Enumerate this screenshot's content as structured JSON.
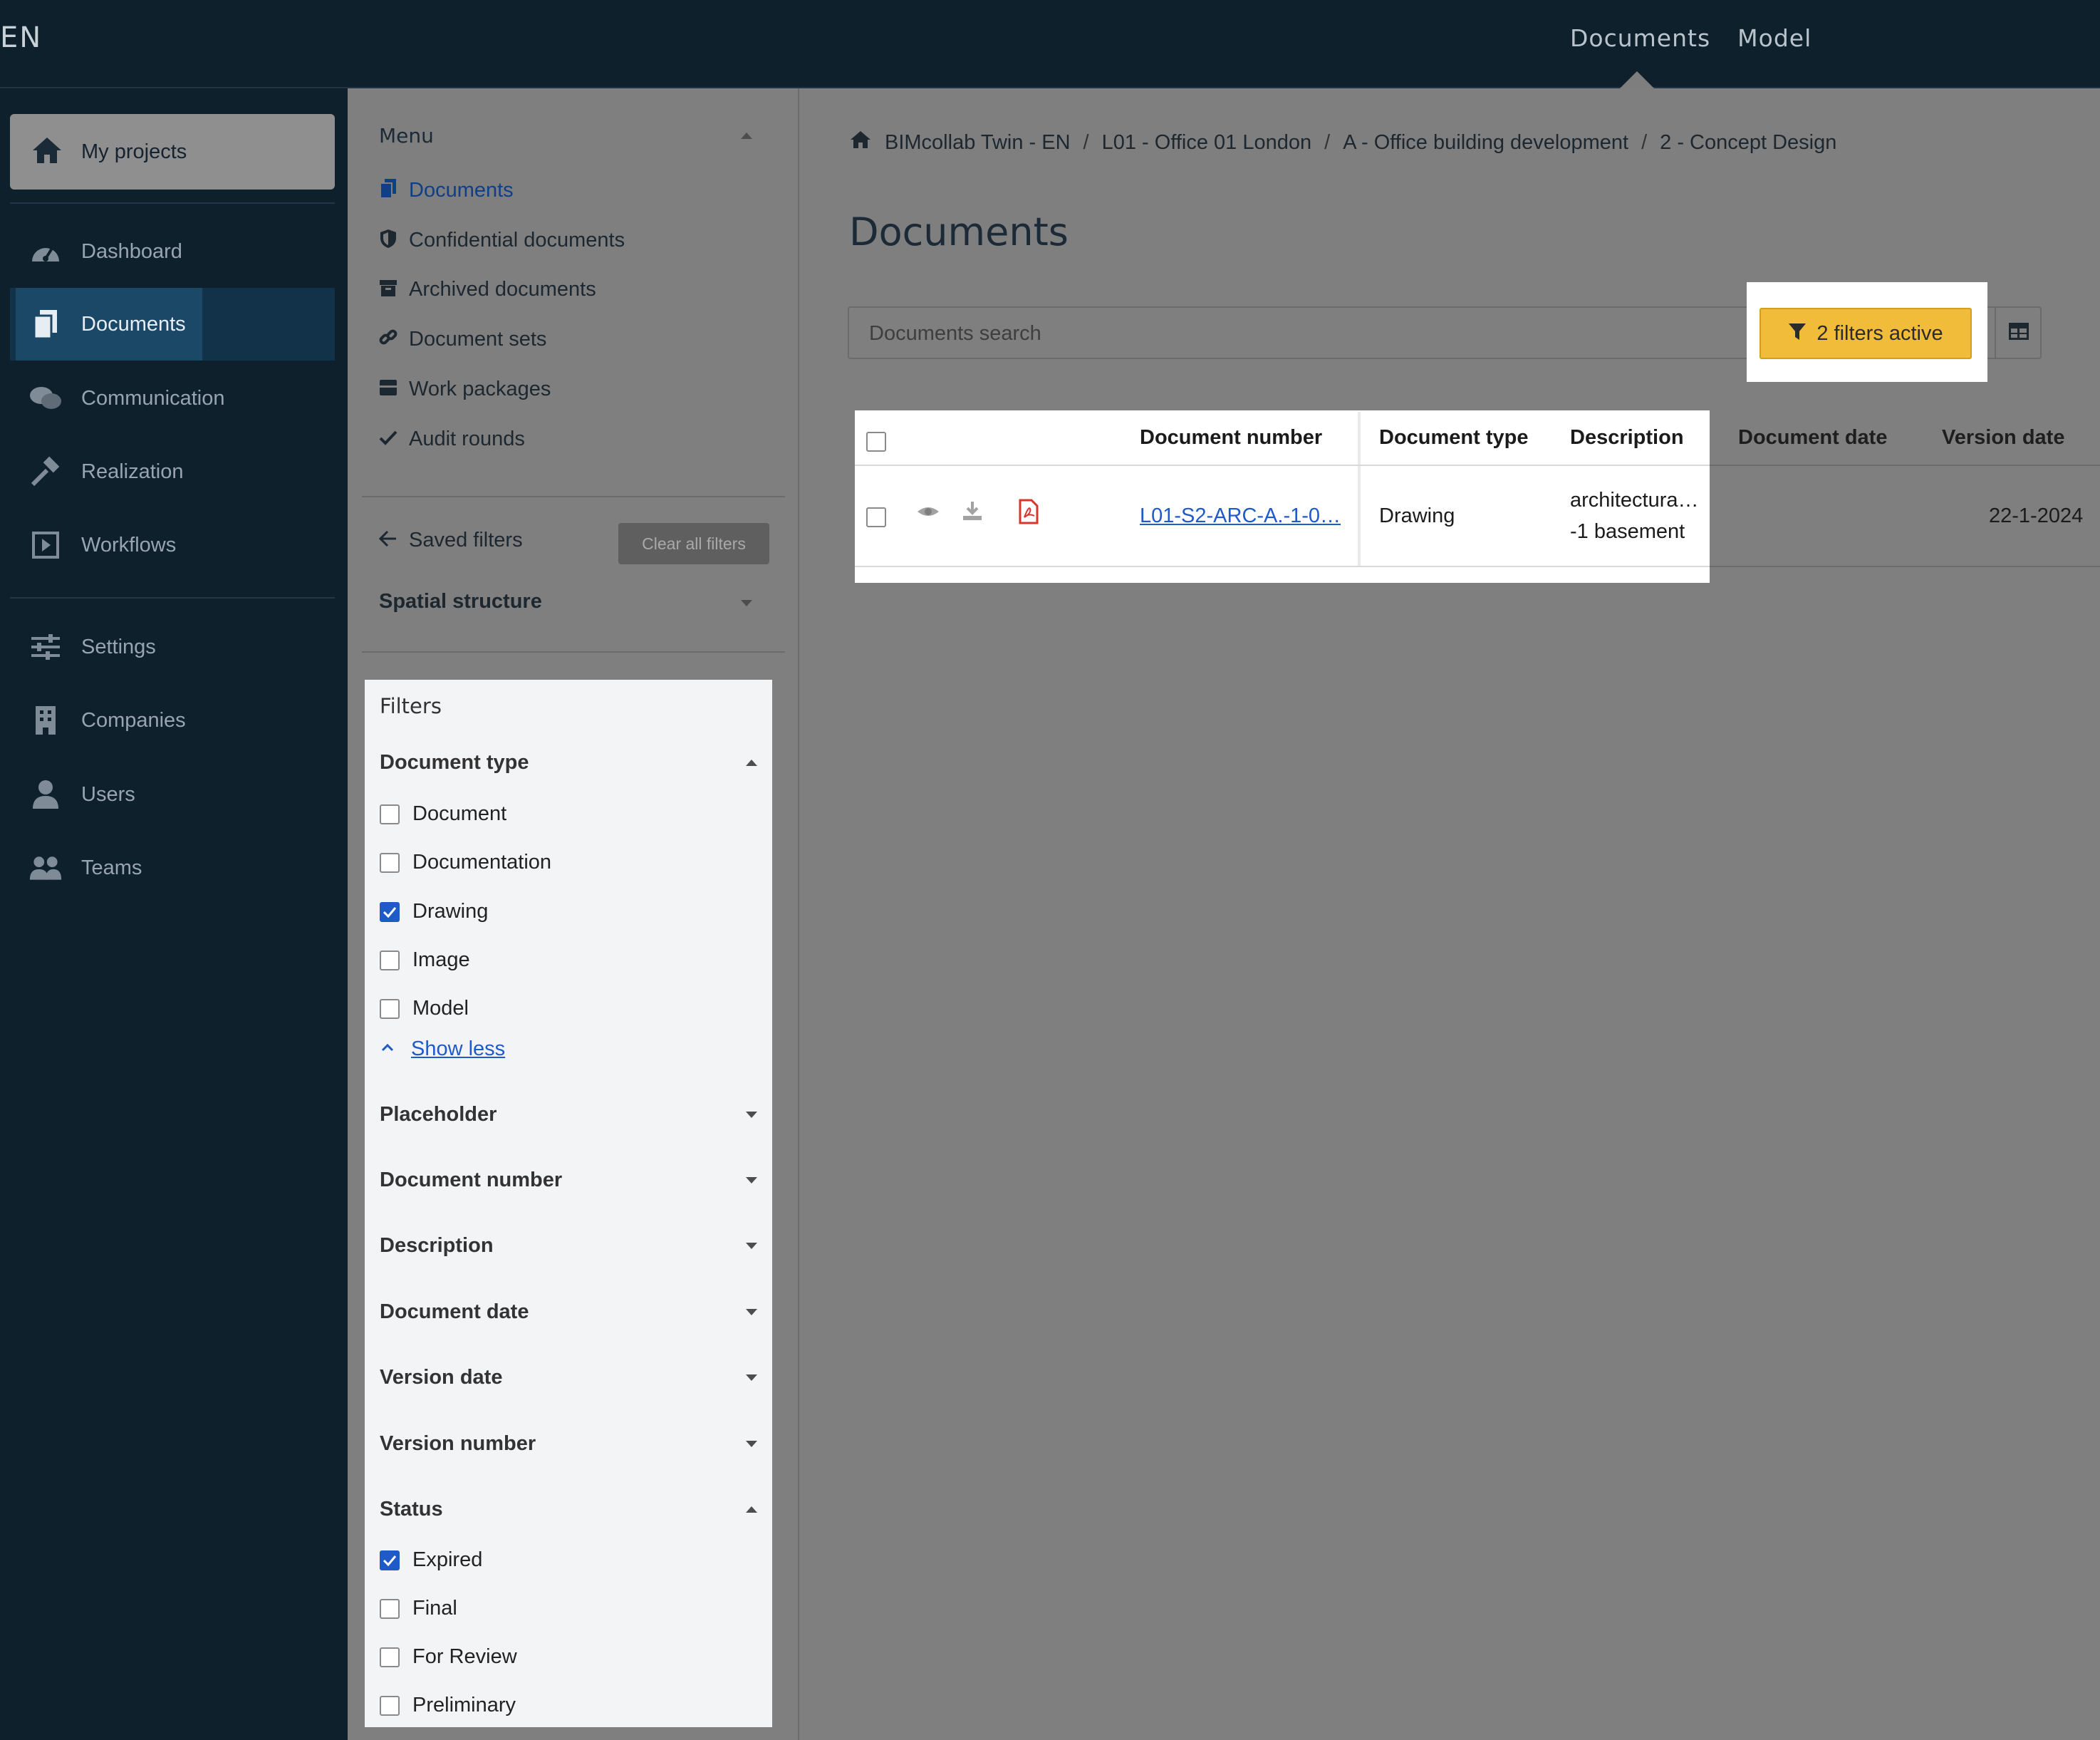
{
  "topbar": {
    "brand": "EN",
    "nav": [
      "Documents",
      "Model"
    ]
  },
  "leftnav": {
    "my_projects": "My projects",
    "items": [
      {
        "label": "Dashboard",
        "icon": "dashboard-icon"
      },
      {
        "label": "Documents",
        "icon": "documents-icon",
        "active": true
      },
      {
        "label": "Communication",
        "icon": "chat-icon"
      },
      {
        "label": "Realization",
        "icon": "hammer-icon"
      },
      {
        "label": "Workflows",
        "icon": "play-square-icon"
      },
      {
        "label": "Settings",
        "icon": "sliders-icon"
      },
      {
        "label": "Companies",
        "icon": "building-icon"
      },
      {
        "label": "Users",
        "icon": "user-icon"
      },
      {
        "label": "Teams",
        "icon": "users-icon"
      }
    ]
  },
  "menu": {
    "title": "Menu",
    "items": [
      {
        "label": "Documents",
        "icon": "copy-icon"
      },
      {
        "label": "Confidential documents",
        "icon": "shield-icon"
      },
      {
        "label": "Archived documents",
        "icon": "archive-icon"
      },
      {
        "label": "Document sets",
        "icon": "link-icon"
      },
      {
        "label": "Work packages",
        "icon": "package-icon"
      },
      {
        "label": "Audit rounds",
        "icon": "check-icon"
      }
    ],
    "saved_filters": "Saved filters",
    "clear_all": "Clear all filters",
    "spatial": "Spatial structure"
  },
  "filters": {
    "title": "Filters",
    "document_type": {
      "label": "Document type",
      "options": [
        {
          "label": "Document",
          "checked": false
        },
        {
          "label": "Documentation",
          "checked": false
        },
        {
          "label": "Drawing",
          "checked": true
        },
        {
          "label": "Image",
          "checked": false
        },
        {
          "label": "Model",
          "checked": false
        }
      ],
      "show_less": "Show less"
    },
    "collapsed": [
      "Placeholder",
      "Document number",
      "Description",
      "Document date",
      "Version date",
      "Version number"
    ],
    "status": {
      "label": "Status",
      "options": [
        {
          "label": "Expired",
          "checked": true
        },
        {
          "label": "Final",
          "checked": false
        },
        {
          "label": "For Review",
          "checked": false
        },
        {
          "label": "Preliminary",
          "checked": false
        }
      ]
    }
  },
  "main": {
    "breadcrumb": [
      "BIMcollab Twin - EN",
      "L01 - Office 01 London",
      "A - Office building development",
      "2 - Concept Design"
    ],
    "title": "Documents",
    "search_placeholder": "Documents search",
    "filter_button": "2 filters active",
    "table": {
      "headers": [
        "Document number",
        "Document type",
        "Description",
        "Document date",
        "Version date"
      ],
      "rows": [
        {
          "document_number": "L01-S2-ARC-A.-1-0…",
          "document_type": "Drawing",
          "description_line1": "architectura…",
          "description_line2": "-1 basement",
          "document_date": "",
          "version_date": "22-1-2024"
        }
      ]
    }
  },
  "colors": {
    "nav_bg": "#0f202d",
    "overlay_gray": "#7f7f7f",
    "accent_yellow": "#f0bc3a",
    "link_blue": "#1e5ac8",
    "pdf_red": "#d9352a"
  }
}
